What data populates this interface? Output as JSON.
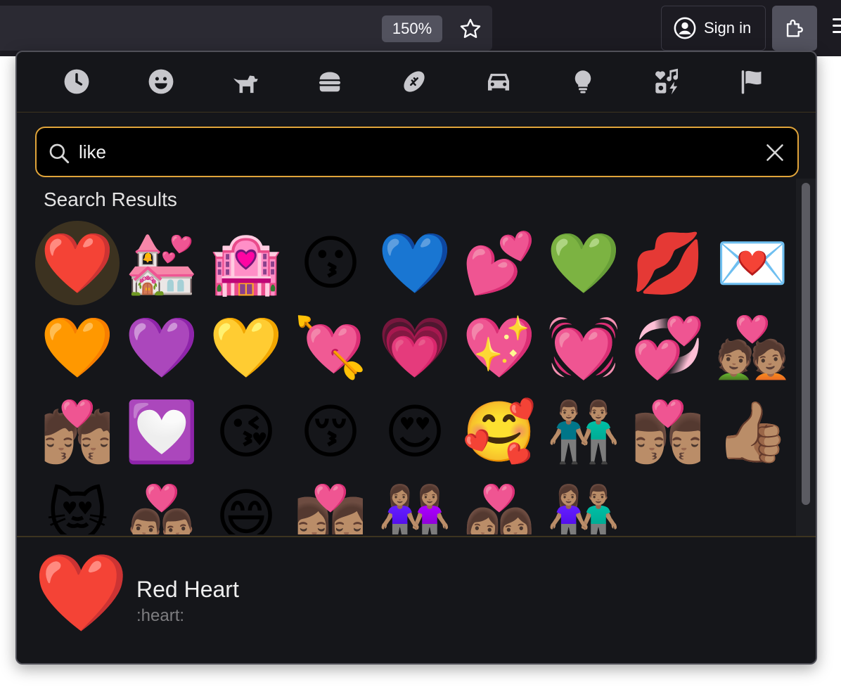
{
  "browser": {
    "zoom_level": "150%",
    "sign_in_label": "Sign in",
    "icons": [
      "star-icon",
      "account-icon",
      "extensions-icon",
      "menu-icon"
    ]
  },
  "panel": {
    "categories": [
      {
        "name": "recent",
        "icon": "clock-icon"
      },
      {
        "name": "smileys",
        "icon": "smiley-icon"
      },
      {
        "name": "animals",
        "icon": "dog-icon"
      },
      {
        "name": "food",
        "icon": "burger-icon"
      },
      {
        "name": "activities",
        "icon": "football-icon"
      },
      {
        "name": "travel",
        "icon": "car-icon"
      },
      {
        "name": "objects",
        "icon": "lightbulb-icon"
      },
      {
        "name": "symbols",
        "icon": "symbols-icon"
      },
      {
        "name": "flags",
        "icon": "flag-icon"
      }
    ],
    "search": {
      "value": "like",
      "accent_color": "#e0a43a"
    },
    "results_title": "Search Results",
    "results": [
      [
        "❤️",
        "💒",
        "🏩",
        "😗",
        "💙",
        "💕",
        "💚",
        "💋",
        "💌"
      ],
      [
        "🧡",
        "💜",
        "💛",
        "💘",
        "💗",
        "💖",
        "💓",
        "💞",
        "💑🏽"
      ],
      [
        "💏🏽",
        "💟",
        "😘",
        "😚",
        "😍",
        "🥰",
        "👬🏽",
        "👨🏽‍❤️‍💋‍👨🏽",
        "👍🏽"
      ],
      [
        "😻",
        "👨🏽‍❤️‍👨🏽",
        "😄",
        "👩🏽‍❤️‍💋‍👩🏽",
        "👭🏽",
        "👩🏽‍❤️‍👩🏽",
        "👫🏽"
      ]
    ],
    "selected_index": [
      0,
      0
    ],
    "preview": {
      "emoji": "❤️",
      "name": "Red Heart",
      "shortcode": ":heart:"
    }
  }
}
